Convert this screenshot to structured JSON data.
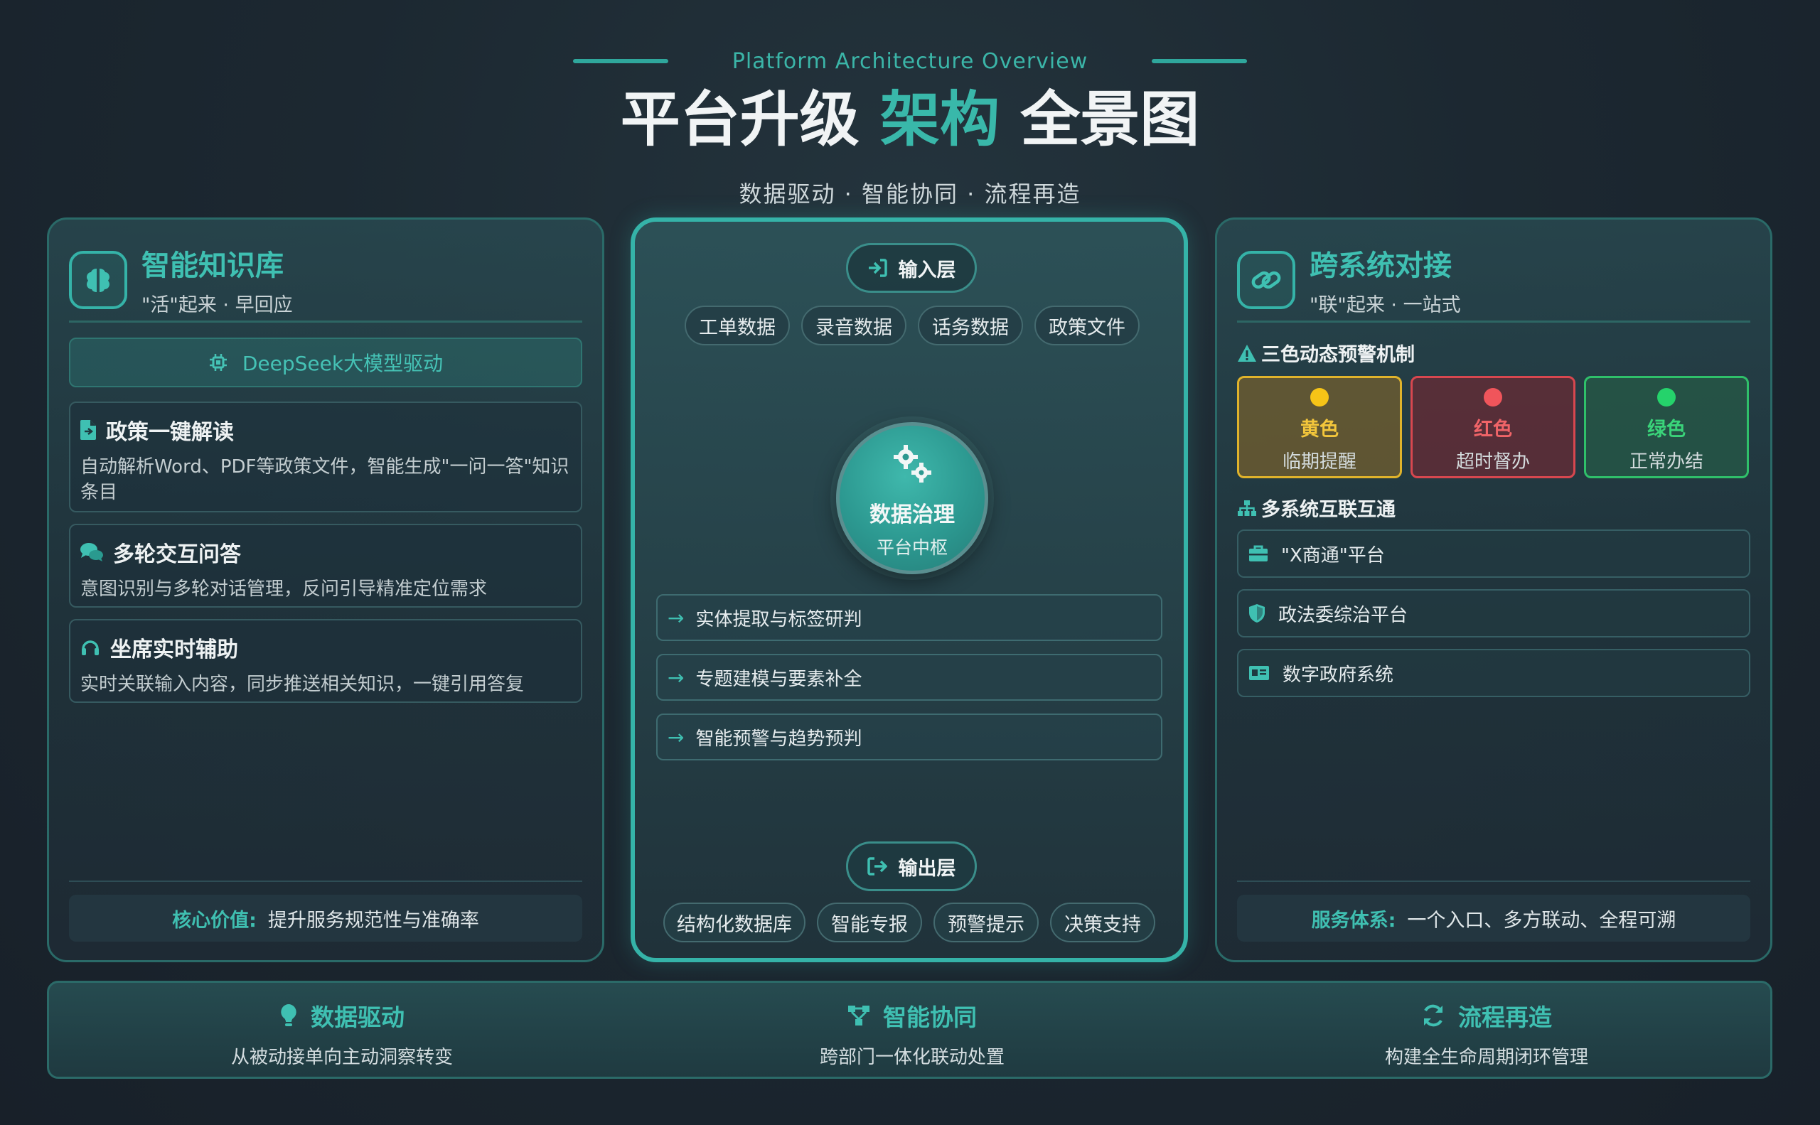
{
  "header": {
    "eyebrow": "Platform Architecture Overview",
    "title_a": "平台升级",
    "title_b": "架构",
    "title_c": "全景图",
    "subtitle": "数据驱动 · 智能协同 · 流程再造"
  },
  "left": {
    "title": "智能知识库",
    "subtitle": "\"活\"起来 · 早回应",
    "banner": "DeepSeek大模型驱动",
    "features": [
      {
        "title": "政策一键解读",
        "desc": "自动解析Word、PDF等政策文件，智能生成\"一问一答\"知识条目"
      },
      {
        "title": "多轮交互问答",
        "desc": "意图识别与多轮对话管理，反问引导精准定位需求"
      },
      {
        "title": "坐席实时辅助",
        "desc": "实时关联输入内容，同步推送相关知识，一键引用答复"
      }
    ],
    "core_label": "核心价值:",
    "core_text": "提升服务规范性与准确率"
  },
  "center": {
    "input_label": "输入层",
    "inputs": [
      "工单数据",
      "录音数据",
      "话务数据",
      "政策文件"
    ],
    "hub_title": "数据治理",
    "hub_sub": "平台中枢",
    "processes": [
      "实体提取与标签研判",
      "专题建模与要素补全",
      "智能预警与趋势预判"
    ],
    "output_label": "输出层",
    "outputs": [
      "结构化数据库",
      "智能专报",
      "预警提示",
      "决策支持"
    ]
  },
  "right": {
    "title": "跨系统对接",
    "subtitle": "\"联\"起来 · 一站式",
    "alert_section": "三色动态预警机制",
    "alerts": [
      {
        "color": "黄色",
        "desc": "临期提醒"
      },
      {
        "color": "红色",
        "desc": "超时督办"
      },
      {
        "color": "绿色",
        "desc": "正常办结"
      }
    ],
    "systems_section": "多系统互联互通",
    "systems": [
      "\"X商通\"平台",
      "政法委综治平台",
      "数字政府系统"
    ],
    "service_label": "服务体系:",
    "service_text": "一个入口、多方联动、全程可溯"
  },
  "footer": [
    {
      "title": "数据驱动",
      "desc": "从被动接单向主动洞察转变"
    },
    {
      "title": "智能协同",
      "desc": "跨部门一体化联动处置"
    },
    {
      "title": "流程再造",
      "desc": "构建全生命周期闭环管理"
    }
  ],
  "colors": {
    "accent": "#39b8aa",
    "yellow": "#f6c417",
    "red": "#f0555b",
    "green": "#25d36b"
  },
  "icons": {
    "left_panel": "brain-icon",
    "banner": "chip-icon",
    "features": [
      "document-icon",
      "chat-bubbles-icon",
      "headset-icon"
    ],
    "input": "sign-in-icon",
    "hub": "gears-icon",
    "process": "arrow-right-icon",
    "output": "sign-out-icon",
    "right_panel": "link-icon",
    "alert": "warning-icon",
    "systems": "sitemap-icon",
    "system_items": [
      "briefcase-icon",
      "shield-icon",
      "id-card-icon"
    ],
    "footer": [
      "lightbulb-icon",
      "network-icon",
      "sync-icon"
    ]
  }
}
